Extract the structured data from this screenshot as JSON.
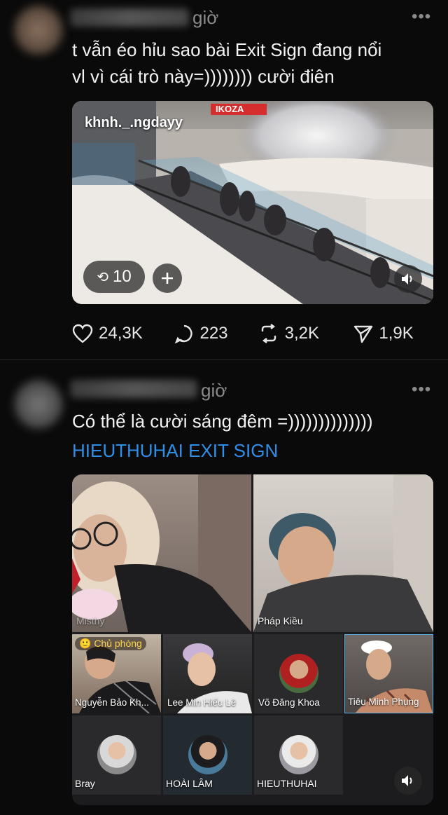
{
  "post1": {
    "time_suffix": "giờ",
    "text_line1": "t vẫn éo hỉu sao bài Exit Sign đang nổi",
    "text_line2": "vl vì cái trò này=)))))))) cười điên",
    "video": {
      "watermark": "khnh._.ngdayy",
      "store_sign": "IKOZA",
      "repost_count": "10",
      "plus_icon": "plus-icon",
      "sound_icon": "speaker-icon"
    },
    "actions": {
      "likes": "24,3K",
      "comments": "223",
      "reposts": "3,2K",
      "shares": "1,9K"
    }
  },
  "post2": {
    "time_suffix": "giờ",
    "text": "Có thể là cười sáng đêm =))))))))))))))",
    "link": "HIEUTHUHAI EXIT SIGN",
    "grid": {
      "host_badge": "🙂 Chủ phòng",
      "tiles": [
        {
          "label": "Misthy"
        },
        {
          "label": "Pháp Kiều"
        },
        {
          "label": "Nguyễn Bảo Kh..."
        },
        {
          "label": "Lee Min Hiếu Lê"
        },
        {
          "label": "Võ Đăng Khoa"
        },
        {
          "label": "Tiêu Minh Phụng"
        },
        {
          "label": "Bray"
        },
        {
          "label": "HOÀI LÂM"
        },
        {
          "label": "HIEUTHUHAI"
        }
      ]
    }
  }
}
